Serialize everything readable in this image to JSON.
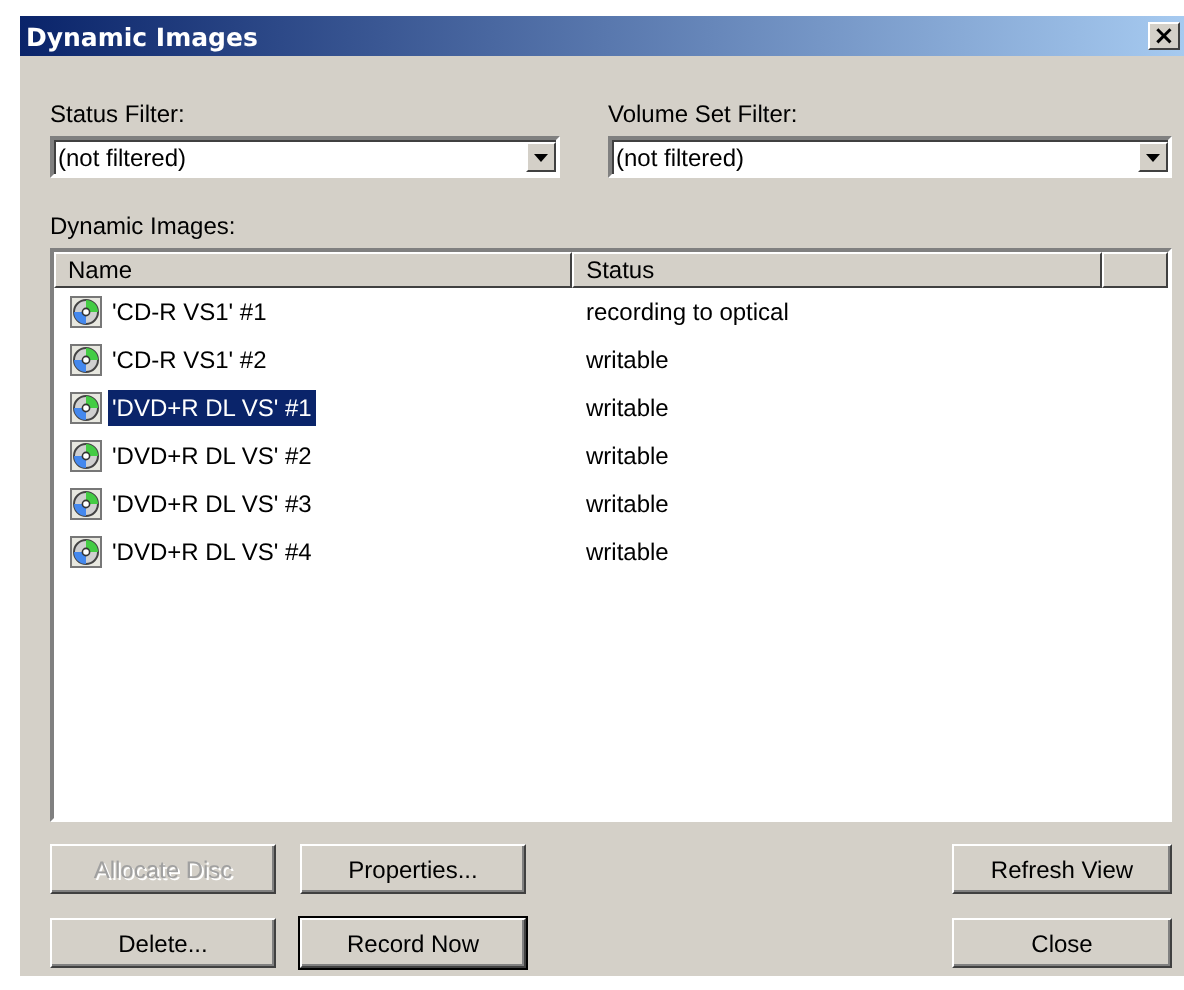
{
  "window": {
    "title": "Dynamic Images",
    "close": "×"
  },
  "filters": [
    {
      "label": "Status Filter:",
      "value": "(not filtered)"
    },
    {
      "label": "Volume Set Filter:",
      "value": "(not filtered)"
    }
  ],
  "list": {
    "label": "Dynamic Images:",
    "columns": [
      "Name",
      "Status"
    ],
    "rows": [
      {
        "name": "'CD-R VS1' #1",
        "status": "recording to optical",
        "selected": false
      },
      {
        "name": "'CD-R VS1' #2",
        "status": "writable",
        "selected": false
      },
      {
        "name": "'DVD+R DL VS' #1",
        "status": "writable",
        "selected": true
      },
      {
        "name": "'DVD+R DL VS' #2",
        "status": "writable",
        "selected": false
      },
      {
        "name": "'DVD+R DL VS' #3",
        "status": "writable",
        "selected": false
      },
      {
        "name": "'DVD+R DL VS' #4",
        "status": "writable",
        "selected": false
      }
    ]
  },
  "buttons": [
    {
      "label": "Allocate Disc",
      "disabled": true,
      "default": false,
      "kind": "left"
    },
    {
      "label": "Properties...",
      "disabled": false,
      "default": false,
      "kind": "left"
    },
    {
      "label": "Refresh View",
      "disabled": false,
      "default": false,
      "kind": "right"
    },
    {
      "label": "Delete...",
      "disabled": false,
      "default": false,
      "kind": "left"
    },
    {
      "label": "Record Now",
      "disabled": false,
      "default": true,
      "kind": "left"
    },
    {
      "label": "Close",
      "disabled": false,
      "default": false,
      "kind": "right"
    }
  ]
}
